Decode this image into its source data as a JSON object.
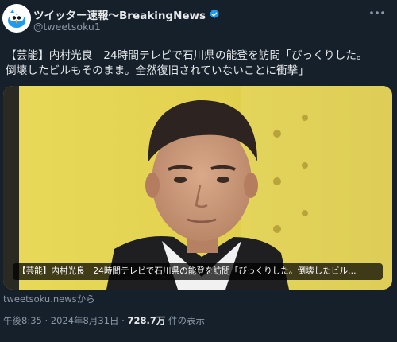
{
  "account": {
    "display_name": "ツイッター速報〜BreakingNews",
    "handle": "@tweetsoku1"
  },
  "tweet": {
    "text_line1": "【芸能】内村光良　24時間テレビで石川県の能登を訪問「びっくりした。",
    "text_line2": "倒壊したビルもそのまま。全然復旧されていないことに衝撃」"
  },
  "card": {
    "caption": "【芸能】内村光良　24時間テレビで石川県の能登を訪問「びっくりした。倒壊したビル…",
    "source": "tweetsoku.newsから"
  },
  "meta": {
    "timestamp": "午後8:35 · 2024年8月31日 · ",
    "views": "728.7万",
    "views_label": " 件の表示"
  },
  "icons": {
    "verified": "verified-badge-icon",
    "more": "more-options-icon",
    "avatar": "avatar-bird-logo"
  },
  "colors": {
    "background": "#15202b",
    "text": "#e7e9ea",
    "secondary": "#8b98a5",
    "verified": "#1d9bf0"
  }
}
